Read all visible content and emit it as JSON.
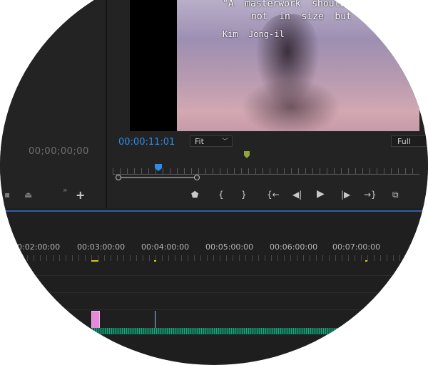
{
  "source_monitor": {
    "timecode": "00;00;00;00"
  },
  "program_monitor": {
    "subtitle_line1": "\"A  masterwork  should",
    "subtitle_line2": "not  in  size  but  in",
    "subtitle_line3": "Kim  Jong-il",
    "current_timecode": "00:00:11:01",
    "zoom_value": "Fit",
    "resolution_value": "Full",
    "playhead_color": "#2d8ceb"
  },
  "controls": {
    "add_marker": "marker-icon",
    "mark_in": "{",
    "mark_out": "}",
    "go_to_in": "go-to-in-icon",
    "step_back": "step-back-icon",
    "play": "play-icon",
    "step_forward": "step-forward-icon",
    "go_to_out": "go-to-out-icon",
    "export_frame": "camera-icon",
    "more": "»",
    "add": "+"
  },
  "timeline": {
    "ruler_labels": [
      "0:02:00:00",
      "00:03:00:00",
      "00:04:00:00",
      "00:05:00:00",
      "00:06:00:00",
      "00:07:00:00"
    ],
    "clip_color": "#e58ad8",
    "audio_color": "#1fa37c"
  }
}
